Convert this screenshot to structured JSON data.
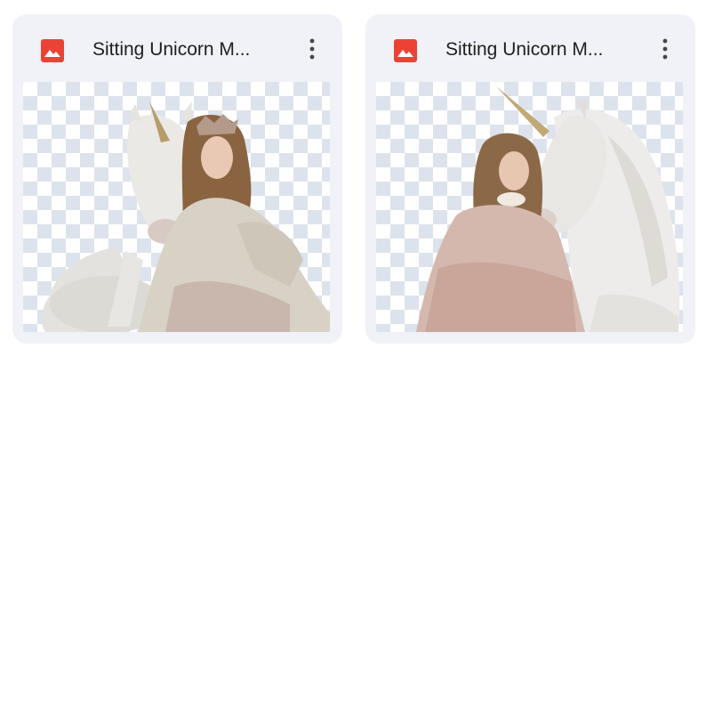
{
  "files": [
    {
      "title": "Sitting Unicorn M...",
      "icon": "image-file-icon",
      "icon_color": "#ea4335",
      "menu_icon": "more-vert-icon"
    },
    {
      "title": "Sitting Unicorn M...",
      "icon": "image-file-icon",
      "icon_color": "#ea4335",
      "menu_icon": "more-vert-icon"
    }
  ]
}
